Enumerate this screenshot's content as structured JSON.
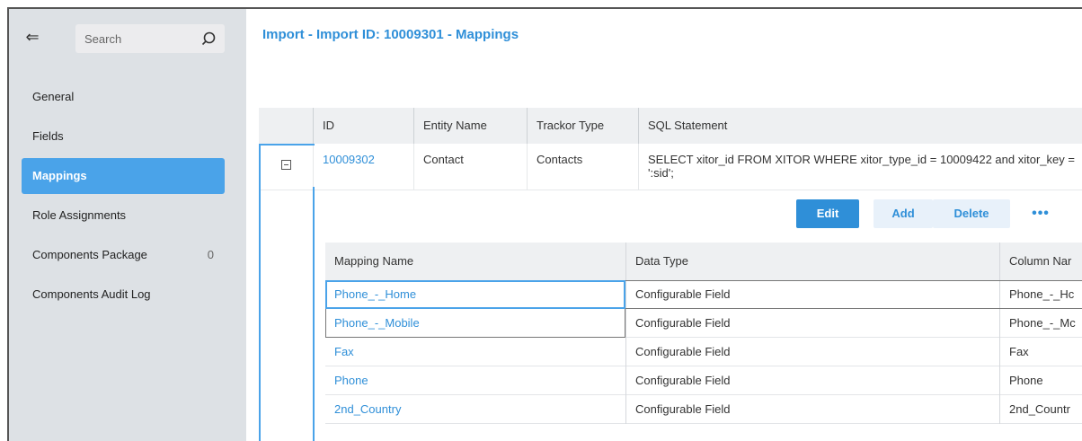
{
  "sidebar": {
    "search_placeholder": "Search",
    "items": [
      {
        "label": "General"
      },
      {
        "label": "Fields"
      },
      {
        "label": "Mappings"
      },
      {
        "label": "Role Assignments"
      },
      {
        "label": "Components Package",
        "count": "0"
      },
      {
        "label": "Components Audit Log"
      }
    ]
  },
  "header": {
    "title": "Import - Import ID: 10009301 - Mappings"
  },
  "parent_table": {
    "columns": [
      "ID",
      "Entity Name",
      "Trackor Type",
      "SQL Statement"
    ],
    "row": {
      "id": "10009302",
      "entity_name": "Contact",
      "trackor_type": "Contacts",
      "sql_statement": "SELECT xitor_id FROM XITOR WHERE xitor_type_id = 10009422 and xitor_key = ':sid';"
    }
  },
  "actions": {
    "edit": "Edit",
    "add": "Add",
    "delete": "Delete",
    "more": "•••"
  },
  "child_table": {
    "columns": [
      "Mapping Name",
      "Data Type",
      "Column Nar"
    ],
    "rows": [
      {
        "mapping_name": "Phone_-_Home",
        "data_type": "Configurable Field",
        "column_name": "Phone_-_Hc"
      },
      {
        "mapping_name": "Phone_-_Mobile",
        "data_type": "Configurable Field",
        "column_name": "Phone_-_Mc"
      },
      {
        "mapping_name": "Fax",
        "data_type": "Configurable Field",
        "column_name": "Fax"
      },
      {
        "mapping_name": "Phone",
        "data_type": "Configurable Field",
        "column_name": "Phone"
      },
      {
        "mapping_name": "2nd_Country",
        "data_type": "Configurable Field",
        "column_name": "2nd_Countr"
      }
    ]
  },
  "colors": {
    "accent": "#2f8fd8",
    "active_nav": "#4aa3e9",
    "sidebar_bg": "#dde1e5"
  }
}
